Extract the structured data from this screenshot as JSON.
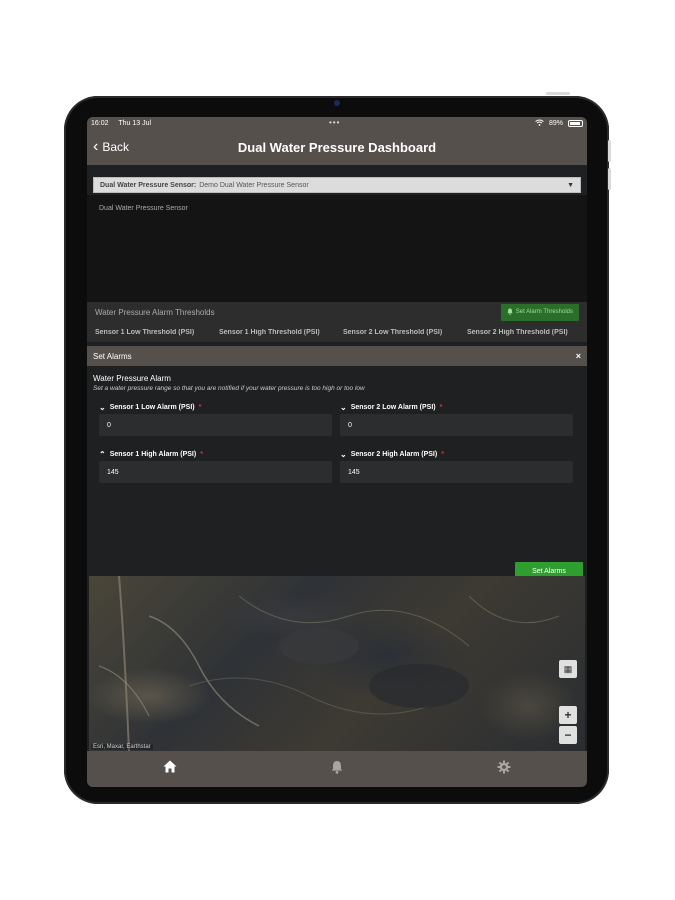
{
  "status": {
    "time": "16:02",
    "date": "Thu 13 Jul",
    "dots": "•••",
    "battery": "89%"
  },
  "nav": {
    "back_label": "Back",
    "title": "Dual Water Pressure Dashboard"
  },
  "selector": {
    "label": "Dual Water Pressure Sensor:",
    "value": "Demo Dual Water Pressure Sensor"
  },
  "sensor_panel": {
    "title": "Dual Water Pressure Sensor"
  },
  "thresholds": {
    "title": "Water Pressure Alarm Thresholds",
    "button_label": "Set Alarm Thresholds",
    "columns": [
      "Sensor 1 Low Threshold (PSI)",
      "Sensor 1 High Threshold (PSI)",
      "Sensor 2 Low Threshold (PSI)",
      "Sensor 2 High Threshold (PSI)"
    ]
  },
  "modal": {
    "title": "Set Alarms",
    "close": "×",
    "alarm_title": "Water Pressure Alarm",
    "alarm_sub": "Set a water pressure range so that you are notified if your water pressure is too high or too low",
    "fields": [
      {
        "label": "Sensor 1 Low Alarm (PSI)",
        "required": "*",
        "value": "0",
        "chevron": "⌄"
      },
      {
        "label": "Sensor 2 Low Alarm (PSI)",
        "required": "*",
        "value": "0",
        "chevron": "⌄"
      },
      {
        "label": "Sensor 1 High Alarm (PSI)",
        "required": "*",
        "value": "145",
        "chevron": "⌃"
      },
      {
        "label": "Sensor 2 High Alarm (PSI)",
        "required": "*",
        "value": "145",
        "chevron": "⌄"
      }
    ],
    "submit_label": "Set Alarms"
  },
  "map": {
    "zoom_in": "+",
    "zoom_out": "−",
    "credit": "Esri, Maxar, Earthstar"
  },
  "tabbar": {
    "icons": [
      "home-icon",
      "bell-icon",
      "gear-icon"
    ]
  },
  "colors": {
    "header": "#56504d",
    "accent_green": "#2e9e2e",
    "background": "#1f2021"
  }
}
